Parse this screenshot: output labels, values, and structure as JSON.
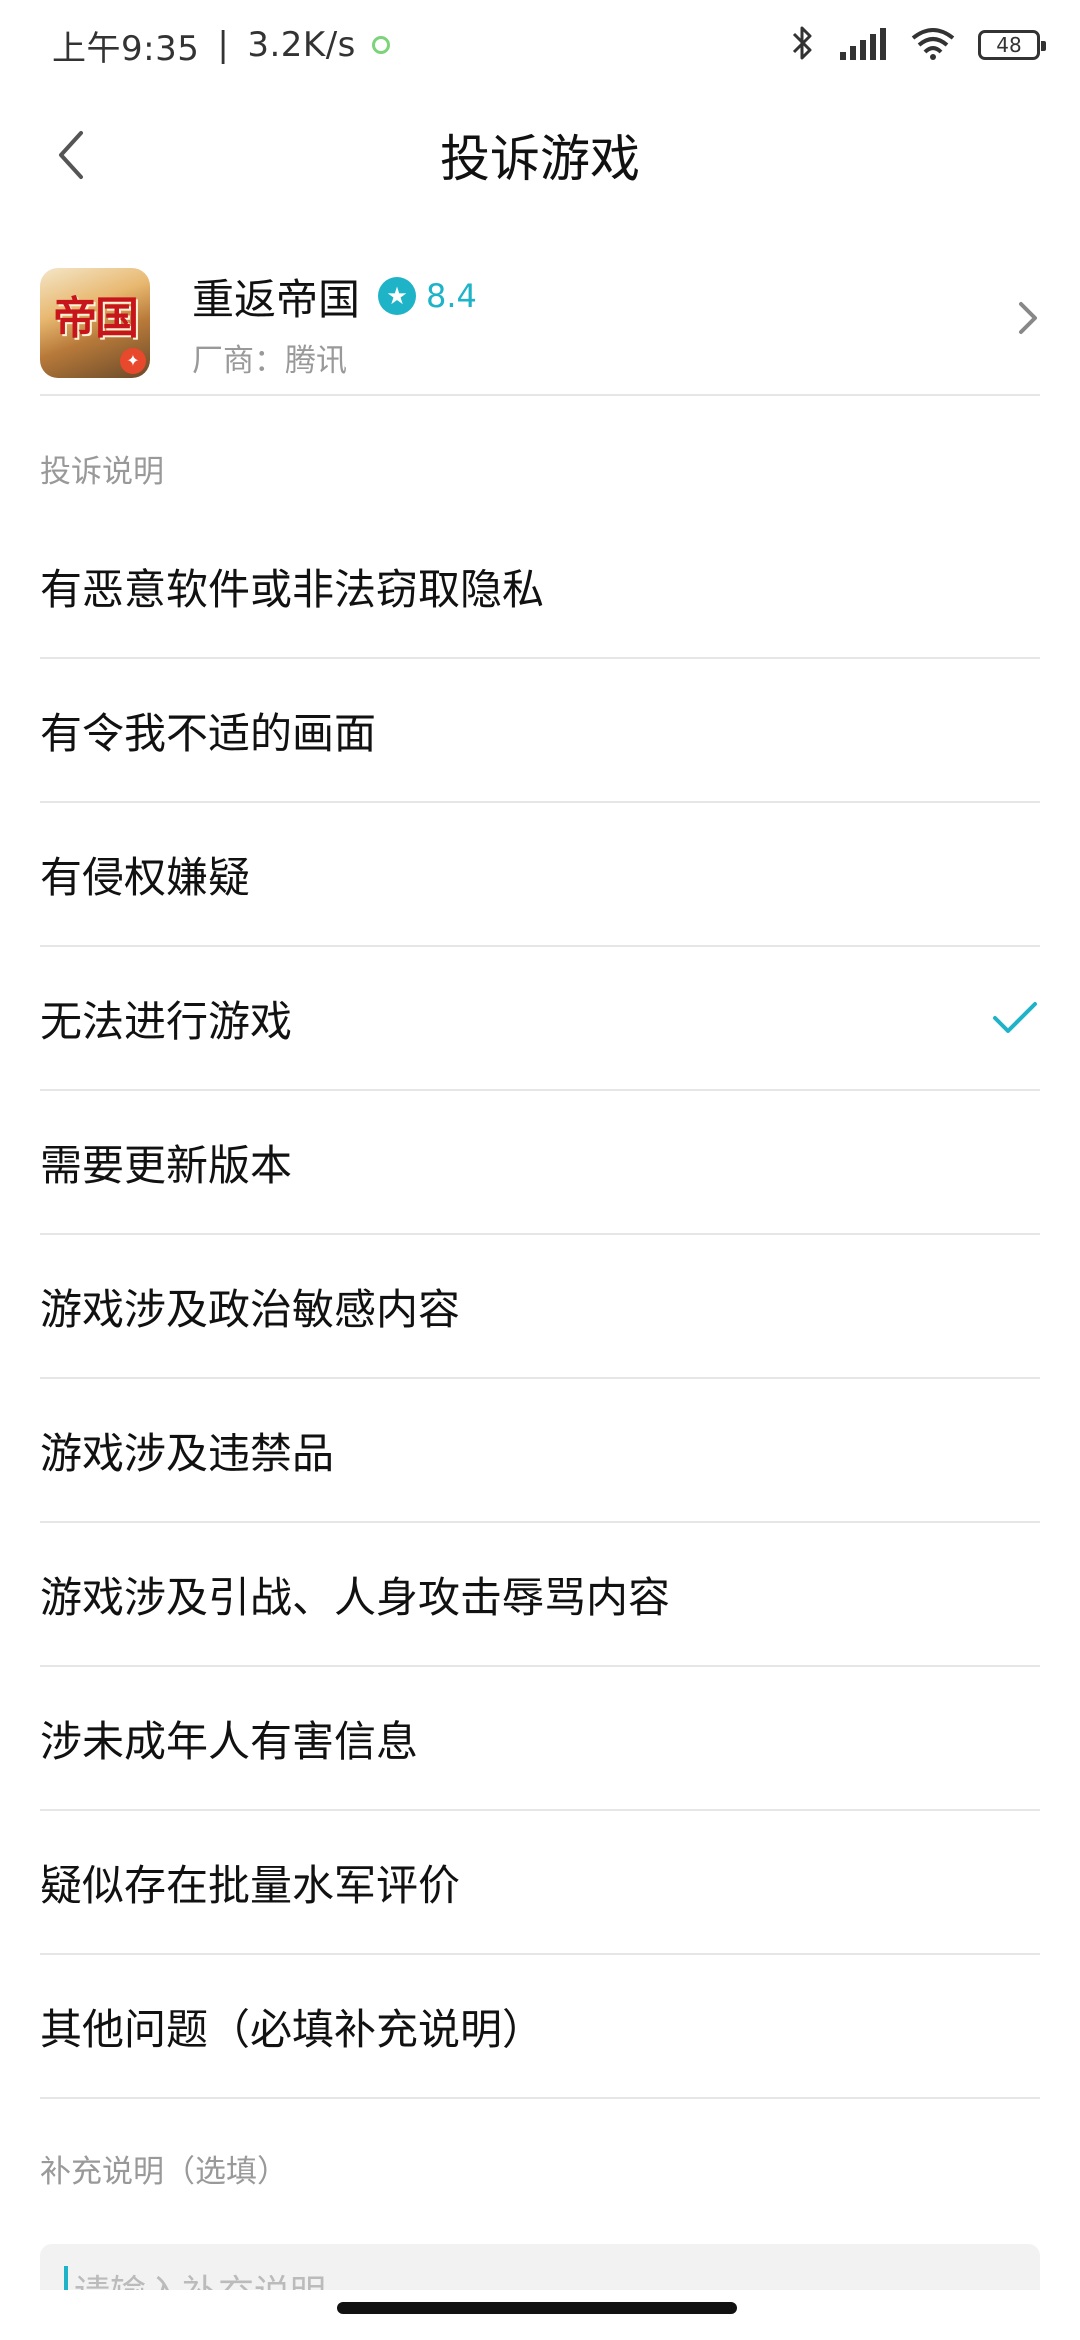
{
  "status_bar": {
    "time": "上午9:35",
    "separator": "|",
    "network_speed": "3.2K/s",
    "battery_level": "48",
    "icons": [
      "bluetooth-icon",
      "signal-icon",
      "wifi-icon",
      "battery-icon"
    ]
  },
  "header": {
    "title": "投诉游戏"
  },
  "game": {
    "icon_text": "帝国",
    "name": "重返帝国",
    "rating": "8.4",
    "vendor": "厂商：腾讯"
  },
  "complaint_section": {
    "label": "投诉说明",
    "items": [
      {
        "label": "有恶意软件或非法窃取隐私",
        "selected": false
      },
      {
        "label": "有令我不适的画面",
        "selected": false
      },
      {
        "label": "有侵权嫌疑",
        "selected": false
      },
      {
        "label": "无法进行游戏",
        "selected": true
      },
      {
        "label": "需要更新版本",
        "selected": false
      },
      {
        "label": "游戏涉及政治敏感内容",
        "selected": false
      },
      {
        "label": "游戏涉及违禁品",
        "selected": false
      },
      {
        "label": "游戏涉及引战、人身攻击辱骂内容",
        "selected": false
      },
      {
        "label": "涉未成年人有害信息",
        "selected": false
      },
      {
        "label": "疑似存在批量水军评价",
        "selected": false
      },
      {
        "label": "其他问题（必填补充说明）",
        "selected": false
      }
    ]
  },
  "supplement": {
    "label": "补充说明（选填）",
    "placeholder": "请输入补充说明"
  },
  "colors": {
    "accent": "#1fb3c8",
    "divider": "#e6e6e6",
    "muted_text": "#999999"
  }
}
